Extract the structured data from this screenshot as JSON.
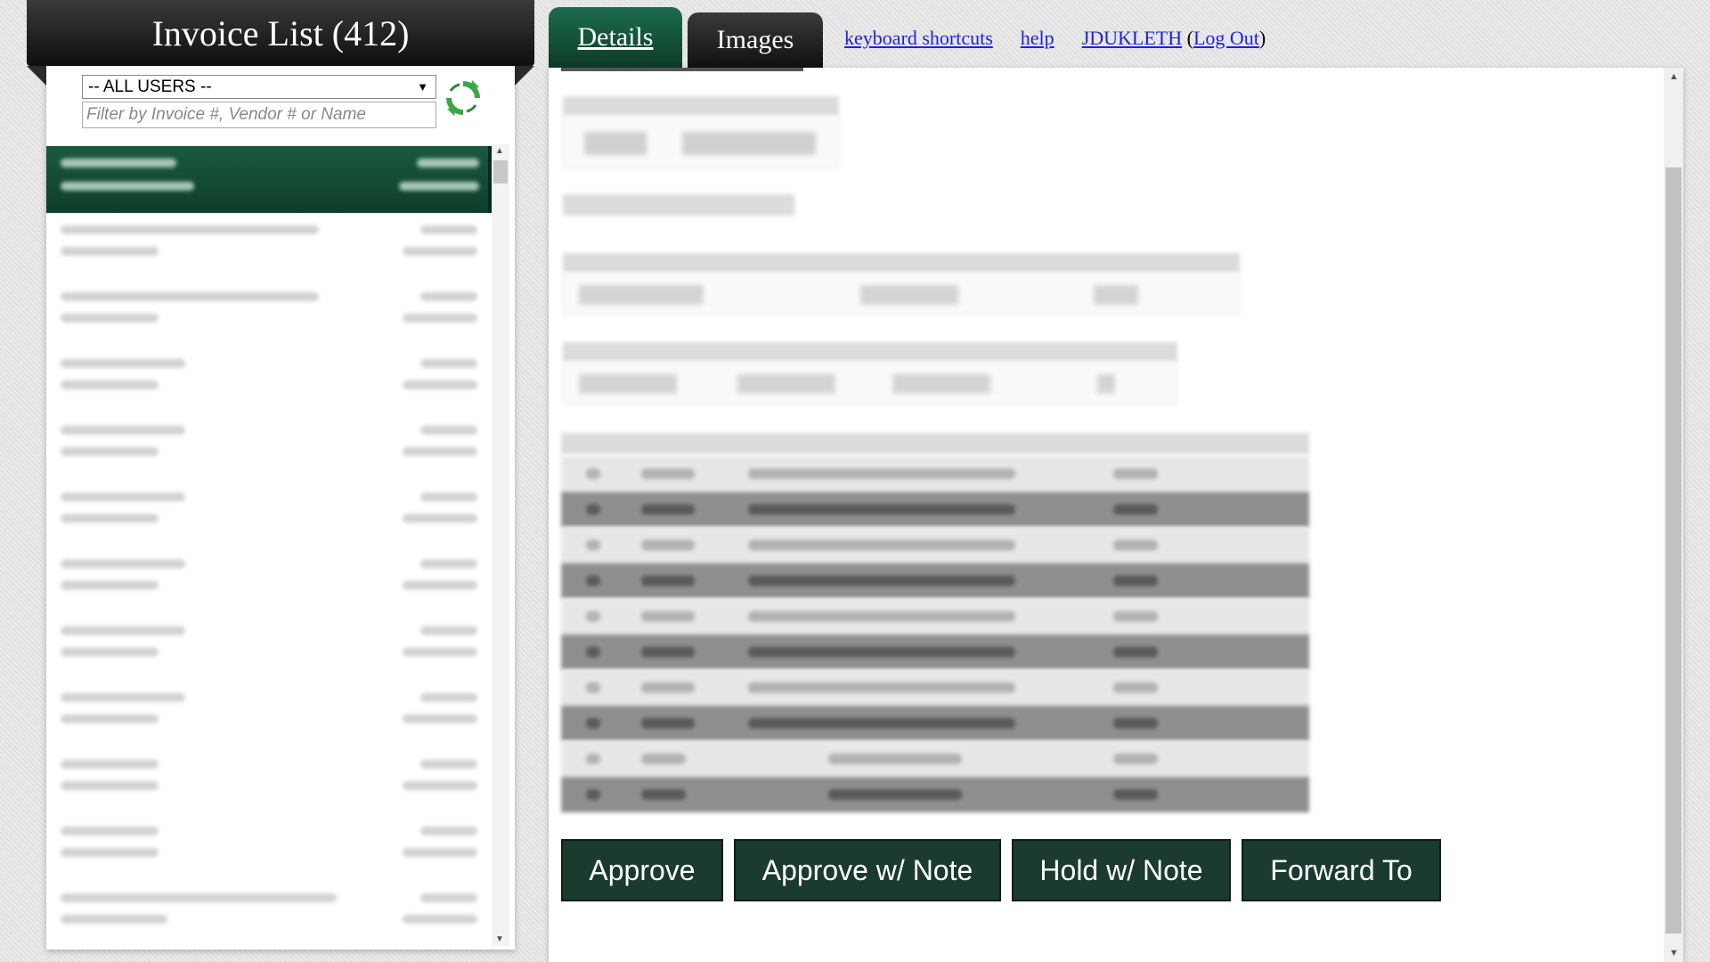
{
  "left": {
    "title": "Invoice List (412)",
    "user_filter_value": "-- ALL USERS --",
    "search_placeholder": "Filter by Invoice #, Vendor # or Name"
  },
  "tabs": {
    "details": "Details",
    "images": "Images"
  },
  "links": {
    "shortcuts": "keyboard shortcuts",
    "help": "help",
    "user": "JDUKLETH",
    "logout": "Log Out"
  },
  "actions": {
    "approve": "Approve",
    "approve_note": "Approve w/ Note",
    "hold_note": "Hold w/ Note",
    "forward": "Forward To"
  }
}
